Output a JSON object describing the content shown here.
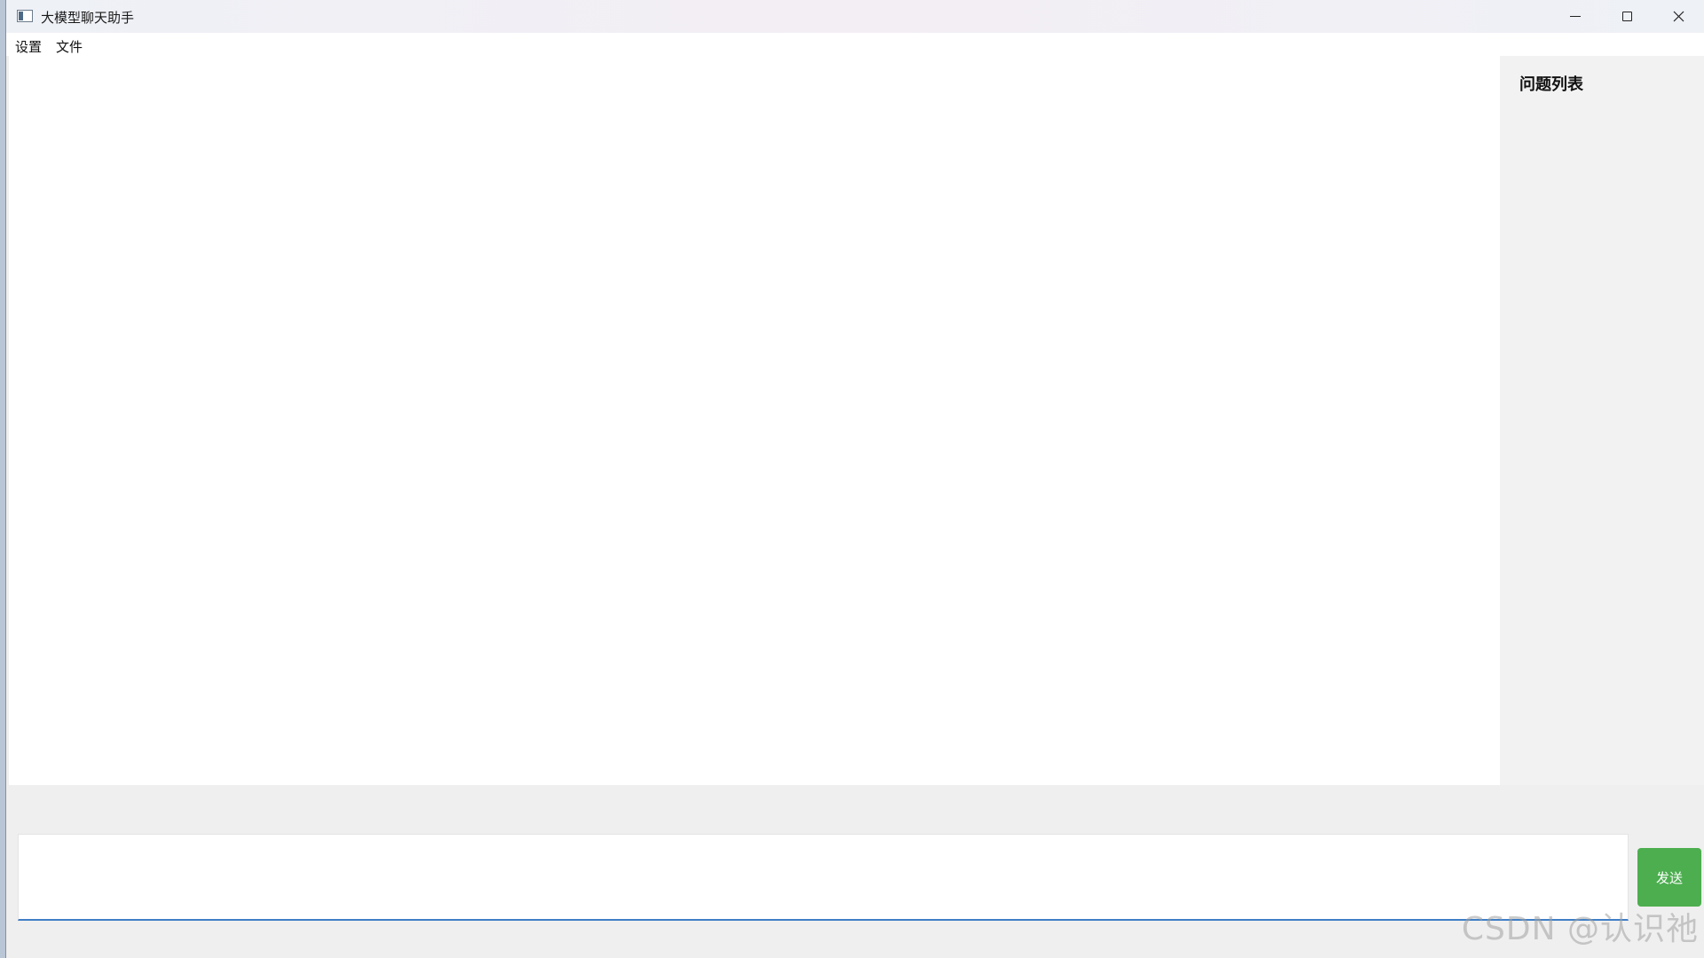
{
  "window": {
    "title": "大模型聊天助手",
    "icon": "app-window-icon"
  },
  "menu": {
    "items": [
      {
        "label": "设置"
      },
      {
        "label": "文件"
      }
    ]
  },
  "question_panel": {
    "title": "问题列表"
  },
  "input": {
    "value": "",
    "placeholder": ""
  },
  "send_button": {
    "label": "发送",
    "color": "#4cae4f"
  },
  "watermark": {
    "text": "CSDN @认识祂"
  },
  "colors": {
    "input_focus_border": "#3f7fc6",
    "panel_bg": "#f2f2f2"
  }
}
